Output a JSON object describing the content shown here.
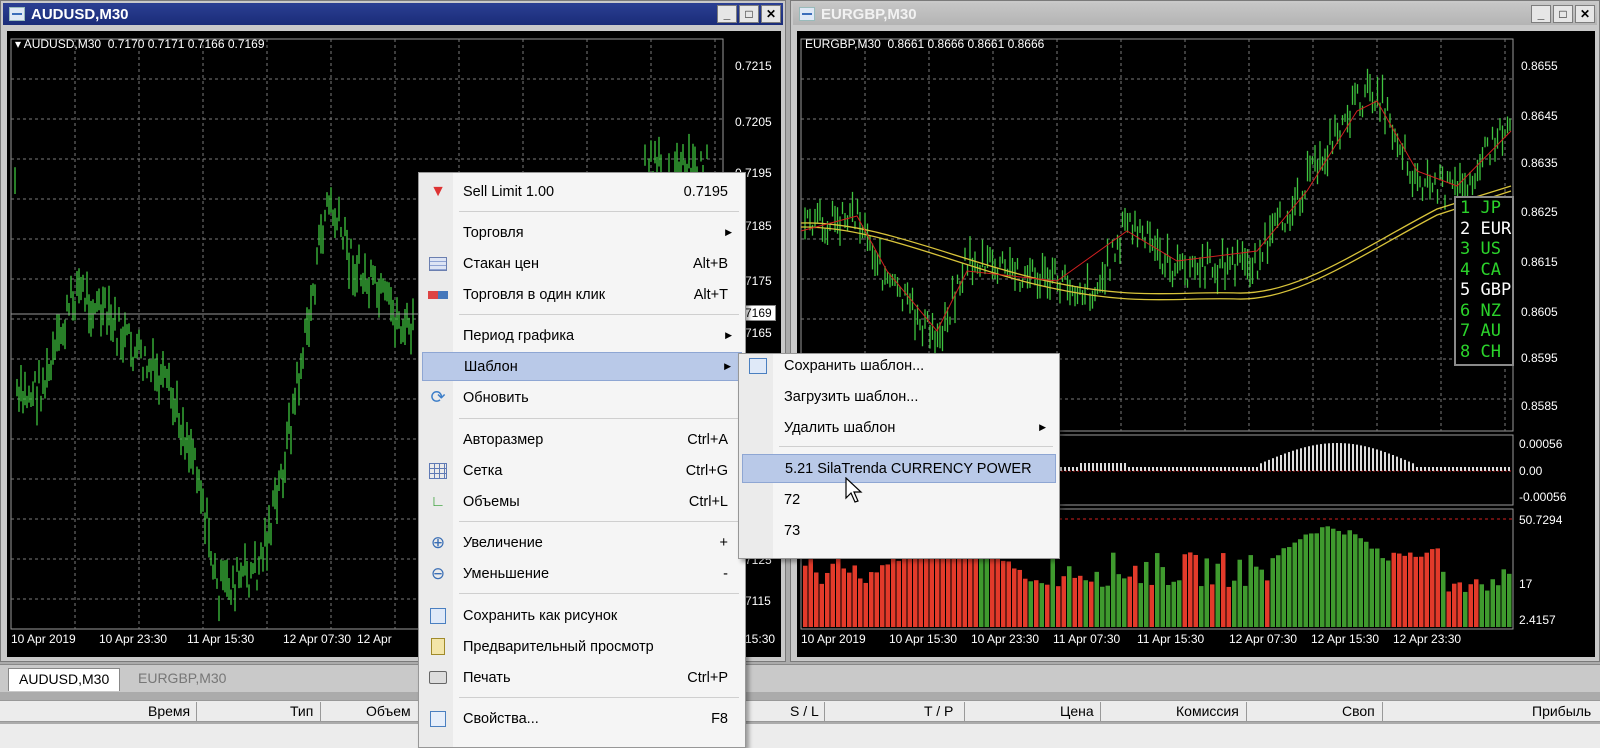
{
  "windows": {
    "left": {
      "title": "AUDUSD,M30",
      "header": "▾ AUDUSD,M30  0.7170 0.7171 0.7166 0.7169",
      "price_axis": [
        "0.7215",
        "0.7205",
        "0.7195",
        "0.7185",
        "0.7175",
        "0.7165",
        "0.7125",
        "0.7115"
      ],
      "current_price": "0.7169",
      "time_axis": [
        "10 Apr 2019",
        "10 Apr 23:30",
        "11 Apr 15:30",
        "12 Apr 07:30",
        "12 Apr",
        "Apr 15:30"
      ]
    },
    "right": {
      "title": "EURGBP,M30",
      "header": "EURGBP,M30  0.8661 0.8666 0.8661 0.8666",
      "price_axis": [
        "0.8655",
        "0.8645",
        "0.8635",
        "0.8625",
        "0.8615",
        "0.8605",
        "0.8595",
        "0.8585"
      ],
      "ind1_axis": [
        "0.00056",
        "0.00",
        "-0.00056"
      ],
      "ind2_axis": [
        "50.7294",
        "17",
        "2.4157"
      ],
      "time_axis": [
        "10 Apr 2019",
        "10 Apr 15:30",
        "10 Apr 23:30",
        "11 Apr 07:30",
        "11 Apr 15:30",
        "12 Apr 07:30",
        "12 Apr 15:30",
        "12 Apr 23:30"
      ]
    }
  },
  "strength_panel": [
    "1 JP",
    "2 EUR",
    "3 US",
    "4 CA",
    "5 GBP",
    "6 NZ",
    "7 AU",
    "8 CH"
  ],
  "tabs": [
    {
      "label": "AUDUSD,M30",
      "active": true
    },
    {
      "label": "EURGBP,M30",
      "active": false
    }
  ],
  "columns": [
    "Время",
    "Тип",
    "Объем",
    "S / L",
    "T / P",
    "Цена",
    "Комиссия",
    "Своп",
    "Прибыль"
  ],
  "context_menu": {
    "items": [
      {
        "label": "Sell Limit 1.00",
        "shortcut": "0.7195",
        "icon": "sell-limit-icon"
      },
      {
        "label": "Торговля",
        "submenu": true
      },
      {
        "label": "Стакан цен",
        "shortcut": "Alt+B",
        "icon": "depth-of-market-icon"
      },
      {
        "label": "Торговля в один клик",
        "shortcut": "Alt+T",
        "icon": "one-click-trading-icon"
      },
      {
        "label": "Период графика",
        "submenu": true
      },
      {
        "label": "Шаблон",
        "submenu": true,
        "highlighted": true
      },
      {
        "label": "Обновить",
        "icon": "refresh-icon"
      },
      {
        "label": "Авторазмер",
        "shortcut": "Ctrl+A"
      },
      {
        "label": "Сетка",
        "shortcut": "Ctrl+G",
        "icon": "grid-icon"
      },
      {
        "label": "Объемы",
        "shortcut": "Ctrl+L",
        "icon": "volumes-icon"
      },
      {
        "label": "Увеличение",
        "shortcut": "+",
        "icon": "zoom-in-icon"
      },
      {
        "label": "Уменьшение",
        "shortcut": "-",
        "icon": "zoom-out-icon"
      },
      {
        "label": "Сохранить как рисунок",
        "icon": "save-picture-icon"
      },
      {
        "label": "Предварительный просмотр",
        "icon": "print-preview-icon"
      },
      {
        "label": "Печать",
        "shortcut": "Ctrl+P",
        "icon": "print-icon"
      },
      {
        "label": "Свойства...",
        "shortcut": "F8",
        "icon": "properties-icon"
      }
    ]
  },
  "template_submenu": {
    "items": [
      {
        "label": "Сохранить шаблон...",
        "icon": "save-template-icon"
      },
      {
        "label": "Загрузить шаблон..."
      },
      {
        "label": "Удалить шаблон",
        "submenu": true
      },
      {
        "label": "5.21 SilaTrenda CURRENCY POWER",
        "highlighted": true
      },
      {
        "label": "72"
      },
      {
        "label": "73"
      }
    ]
  },
  "colors": {
    "candles": "#3fc43f",
    "bear_histogram": "#e23a2a",
    "bull_histogram": "#3f9a2e",
    "ma_line": "#d8c33a",
    "menu_highlight": "#b9c9e8",
    "active_title": "#1f3283"
  }
}
